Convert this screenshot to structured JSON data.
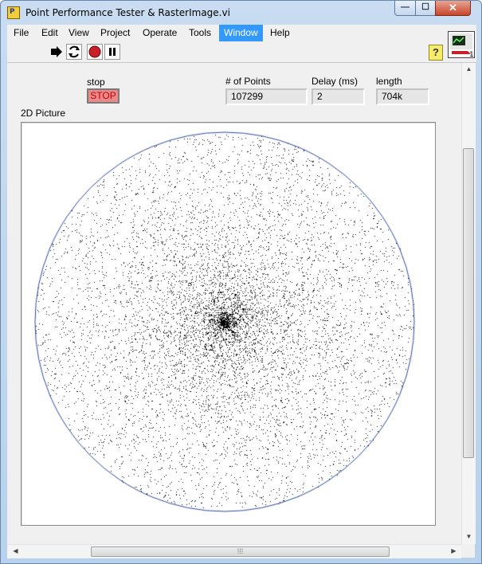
{
  "window": {
    "title": "Point Performance Tester & RasterImage.vi",
    "app_icon_text": "P",
    "minimize_glyph": "—",
    "maximize_glyph": "☐",
    "close_glyph": "✕"
  },
  "menu": {
    "items": [
      {
        "label": "File"
      },
      {
        "label": "Edit"
      },
      {
        "label": "View"
      },
      {
        "label": "Project"
      },
      {
        "label": "Operate"
      },
      {
        "label": "Tools"
      },
      {
        "label": "Window",
        "active": true
      },
      {
        "label": "Help"
      }
    ]
  },
  "toolbar": {
    "buttons": [
      "run-arrow-icon",
      "run-continuously-icon",
      "abort-icon",
      "pause-icon"
    ],
    "help_label": "?",
    "vi_icon_number": "1"
  },
  "panel": {
    "stop": {
      "label": "stop",
      "button_text": "STOP"
    },
    "points": {
      "label": "# of Points",
      "value": "107299"
    },
    "delay": {
      "label": "Delay (ms)",
      "value": "2"
    },
    "length": {
      "label": "length",
      "value": "704k"
    },
    "picture": {
      "label": "2D Picture",
      "content": "scatter-cloud",
      "circle_color": "#2b4a9a",
      "point_color": "#000000"
    }
  },
  "scrollbars": {
    "h_grip": "⁞⁞⁞",
    "v_grip": "≡"
  },
  "colors": {
    "stop_bg": "#e98a8a",
    "stop_text": "#c40000",
    "menu_active": "#3399ff"
  }
}
